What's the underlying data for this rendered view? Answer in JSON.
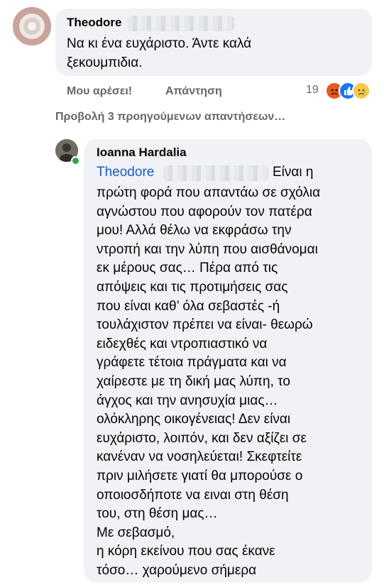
{
  "comment1": {
    "author": "Theodore",
    "text_line1": "Να κι ένα ευχάριστο. Άντε καλά",
    "text_line2": "ξεκουμπιδια.",
    "actions": {
      "like": "Μου αρέσει!",
      "reply": "Απάντηση"
    },
    "reaction_count": "19",
    "reactions": [
      "angry-icon",
      "like-icon",
      "sad-icon"
    ],
    "colors": {
      "angry": "#e65a1f",
      "like": "#1877f2",
      "sad": "#f7c84b"
    }
  },
  "view_previous_replies": "Προβολή 3 προηγούμενων απαντήσεων…",
  "comment2": {
    "author": "Ioanna Hardalia",
    "mention": "Theodore",
    "first_line": "Είναι η",
    "lines": [
      "πρώτη φορά που απαντάω σε σχόλια",
      "αγνώστου που αφορούν τον πατέρα",
      "μου! Αλλά θέλω να εκφράσω την",
      "ντροπή και την λύπη που αισθάνομαι",
      "εκ μέρους σας… Πέρα από τις",
      "απόψεις και τις προτιμήσεις σας",
      "που είναι καθ’ όλα σεβαστές -ή",
      "τουλάχιστον πρέπει να είναι- θεωρώ",
      "ειδεχθές και ντροπιαστικό να",
      "γράφετε τέτοια πράγματα και να",
      "χαίρεστε με τη δική μας λύπη, το",
      "άγχος και την ανησυχία μιας…",
      "ολόκληρης οικογένειας! Δεν είναι",
      "ευχάριστο, λοιπόν, και δεν αξίζει σε",
      "κανέναν να νοσηλεύεται! Σκεφτείτε",
      "πριν μιλήσετε γιατί θα μπορούσε ο",
      "οποιοσδήποτε να ειναι στη θέση",
      "του, στη θέση μας…",
      "Με σεβασμό,",
      "η κόρη εκείνου που σας έκανε",
      "τόσο… χαρούμενο σήμερα"
    ]
  }
}
